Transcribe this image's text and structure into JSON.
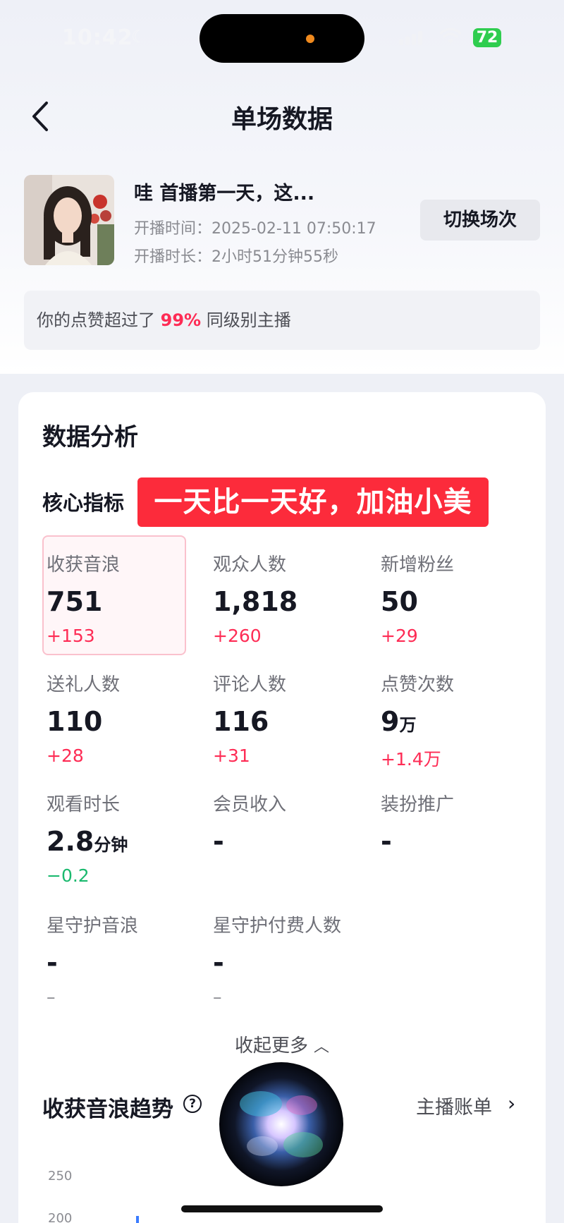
{
  "status_bar": {
    "time": "10:42",
    "battery": "72"
  },
  "header": {
    "title": "单场数据"
  },
  "live": {
    "title": "哇 首播第一天，这...",
    "start_time": "开播时间：2025-02-11 07:50:17",
    "duration": "开播时长：2小时51分钟55秒",
    "switch_label": "切换场次"
  },
  "like_note": {
    "prefix": "你的点赞超过了 ",
    "percent": "99%",
    "suffix": " 同级别主播"
  },
  "analysis": {
    "title": "数据分析",
    "core_label": "核心指标",
    "overlay_text": "一天比一天好，加油小美",
    "metrics": [
      {
        "label": "收获音浪",
        "value": "751",
        "unit": "",
        "delta": "+153",
        "trend": "up",
        "selected": true
      },
      {
        "label": "观众人数",
        "value": "1,818",
        "unit": "",
        "delta": "+260",
        "trend": "up"
      },
      {
        "label": "新增粉丝",
        "value": "50",
        "unit": "",
        "delta": "+29",
        "trend": "up"
      },
      {
        "label": "送礼人数",
        "value": "110",
        "unit": "",
        "delta": "+28",
        "trend": "up"
      },
      {
        "label": "评论人数",
        "value": "116",
        "unit": "",
        "delta": "+31",
        "trend": "up"
      },
      {
        "label": "点赞次数",
        "value": "9",
        "unit": "万",
        "delta": "+1.4万",
        "trend": "up"
      },
      {
        "label": "观看时长",
        "value": "2.8",
        "unit": "分钟",
        "delta": "−0.2",
        "trend": "down"
      },
      {
        "label": "会员收入",
        "value": "-",
        "unit": "",
        "delta": "",
        "trend": "flat"
      },
      {
        "label": "装扮推广",
        "value": "-",
        "unit": "",
        "delta": "",
        "trend": "flat"
      },
      {
        "label": "星守护音浪",
        "value": "-",
        "unit": "",
        "delta": "–",
        "trend": "flat"
      },
      {
        "label": "星守护付费人数",
        "value": "-",
        "unit": "",
        "delta": "–",
        "trend": "flat"
      }
    ],
    "collapse_label": "收起更多"
  },
  "trend": {
    "title": "收获音浪趋势",
    "help_icon": "question-circle-icon",
    "bill_label": "主播账单",
    "y_ticks": [
      "250",
      "200"
    ]
  },
  "colors": {
    "accent_red": "#fe2c55",
    "positive_green": "#1ab96e",
    "overlay_red": "#fc2b3b",
    "battery_green": "#2fcd4f"
  }
}
